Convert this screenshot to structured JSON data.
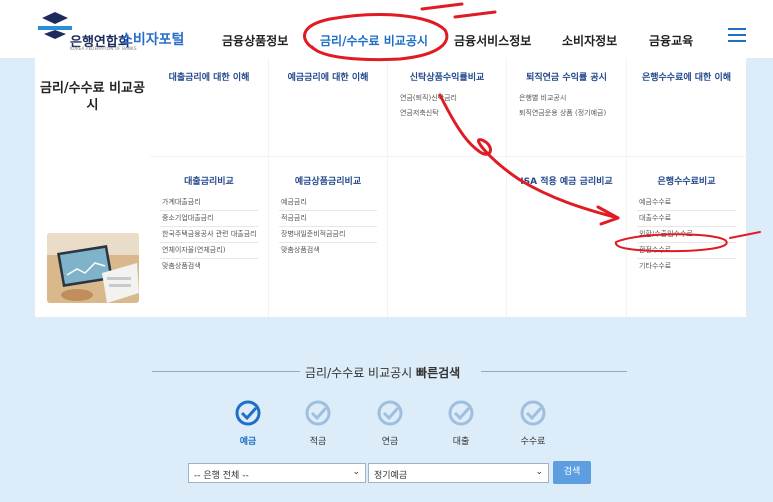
{
  "header": {
    "logo_name": "은행연합회",
    "logo_portal": "소비자포털",
    "logo_sub": "KOREA FEDERATION OF BANKS",
    "nav": [
      "금융상품정보",
      "금리/수수료 비교공시",
      "금융서비스정보",
      "소비자정보",
      "금융교육"
    ],
    "active_index": 1
  },
  "panel": {
    "section_title": "금리/수수료 비교공시",
    "cells": [
      {
        "title": "대출금리에 대한 이해",
        "items": []
      },
      {
        "title": "예금금리에 대한 이해",
        "items": []
      },
      {
        "title": "신탁상품수익률비교",
        "items": [
          "연금(퇴직)신탁금리",
          "연금저축신탁"
        ]
      },
      {
        "title": "퇴직연금 수익률 공시",
        "items": [
          "은행별 비교공시",
          "퇴직연금운용 상품 (정기예금)"
        ]
      },
      {
        "title": "은행수수료에 대한 이해",
        "items": []
      },
      {
        "title": "대출금리비교",
        "items": [
          "가계대출금리",
          "중소기업대출금리",
          "한국주택금융공사 관련 대출금리",
          "연체이자율(연체금리)",
          "맞춤상품검색"
        ]
      },
      {
        "title": "예금상품금리비교",
        "items": [
          "예금금리",
          "적금금리",
          "장병내일준비적금금리",
          "맞춤상품검색"
        ]
      },
      {
        "title": "",
        "items": []
      },
      {
        "title": "ISA 적용 예금 금리비교",
        "items": []
      },
      {
        "title": "은행수수료비교",
        "items": [
          "예금수수료",
          "대출수수료",
          "외환/수출입수수료",
          "환전수수료",
          "기타수수료"
        ]
      }
    ]
  },
  "quick_search": {
    "title_prefix": "금리/수수료 비교공시",
    "title_bold": "빠른검색",
    "tabs": [
      "예금",
      "적금",
      "연금",
      "대출",
      "수수료"
    ],
    "active_tab": 0,
    "bank_select": "-- 은행 전체 --",
    "product_select": "정기예금",
    "search_button": "검색"
  },
  "colors": {
    "accent": "#1f6fc5",
    "annotation": "#e01b24",
    "background": "#dcecf8"
  }
}
